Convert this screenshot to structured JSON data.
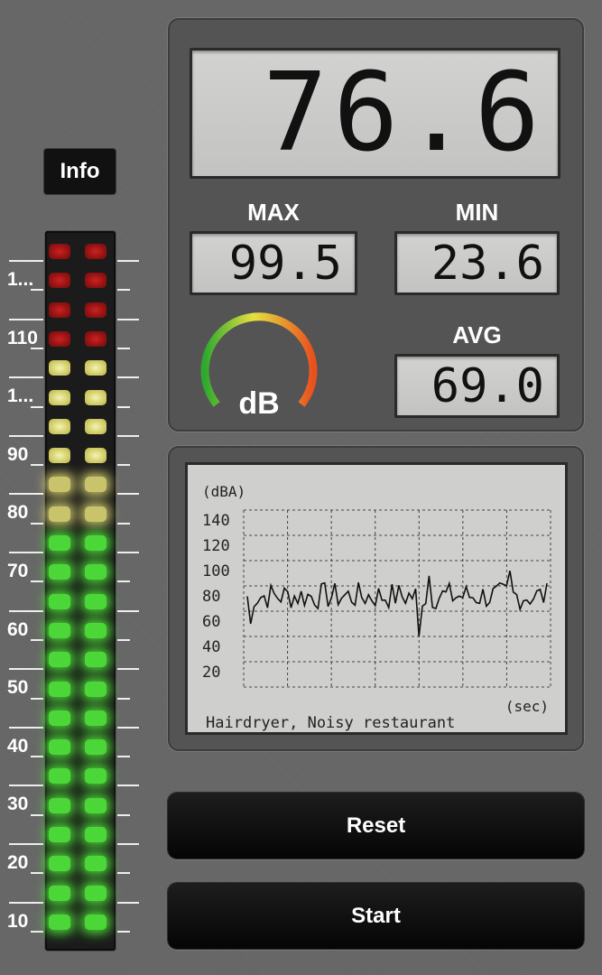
{
  "info_button": {
    "label": "Info"
  },
  "meter": {
    "level_db": 76.6,
    "scale_labels": [
      "1...",
      "110",
      "1...",
      "90",
      "80",
      "70",
      "60",
      "50",
      "40",
      "30",
      "20",
      "10"
    ]
  },
  "main_reading": {
    "value": "76.6"
  },
  "stats": {
    "max_label": "MAX",
    "max_value": "99.5",
    "min_label": "MIN",
    "min_value": "23.6",
    "avg_label": "AVG",
    "avg_value": "69.0"
  },
  "gauge": {
    "label": "dB",
    "icon": "db-gauge-icon"
  },
  "graph": {
    "unit_label": "(dBA)",
    "y_ticks": [
      "140",
      "120",
      "100",
      "80",
      "60",
      "40",
      "20"
    ],
    "x_unit_label": "(sec)",
    "description": "Hairdryer, Noisy restaurant"
  },
  "buttons": {
    "reset_label": "Reset",
    "start_label": "Start"
  },
  "colors": {
    "red_segment": "#8b1010",
    "yellow_segment": "#e8e27a",
    "green_segment": "#4fe23a"
  }
}
